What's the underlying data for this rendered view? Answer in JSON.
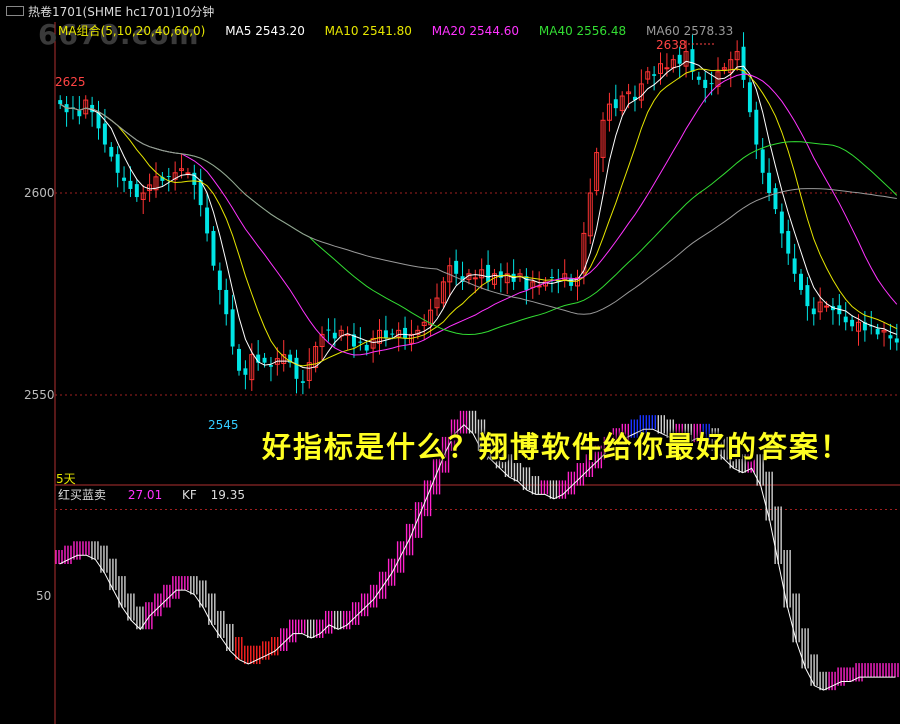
{
  "window": {
    "title": "热卷1701(SHME hc1701)10分钟",
    "watermark": "6670.com"
  },
  "ma_legend": {
    "group_label": "MA组合(5,10,20,40,60,0)",
    "items": [
      {
        "label": "MA5 2543.20",
        "color": "#ffffff"
      },
      {
        "label": "MA10 2541.80",
        "color": "#e6e600"
      },
      {
        "label": "MA20 2544.60",
        "color": "#ff33ff"
      },
      {
        "label": "MA40 2556.48",
        "color": "#33dd33"
      },
      {
        "label": "MA60 2578.33",
        "color": "#999999"
      }
    ]
  },
  "price_axis": {
    "ticks": [
      "2600",
      "2550"
    ]
  },
  "annotations": {
    "high_left": "2625",
    "high_right": "2638",
    "low": "2545",
    "period": "5天"
  },
  "slogan": "好指标是什么？翔博软件给你最好的答案！",
  "indicator": {
    "name": "红买蓝卖",
    "value": "27.01",
    "kf_label": "KF",
    "kf_value": "19.35",
    "axis_tick": "50"
  },
  "chart_data": [
    {
      "type": "candlestick",
      "title": "热卷1701(SHME hc1701)10分钟",
      "ylim": [
        2540,
        2642
      ],
      "series_note": "close values per bar",
      "close": [
        2622,
        2620,
        2621,
        2619,
        2623,
        2620,
        2616,
        2612,
        2609,
        2605,
        2603,
        2601,
        2599,
        2600,
        2602,
        2604,
        2603,
        2604,
        2605,
        2606,
        2605,
        2602,
        2597,
        2590,
        2582,
        2576,
        2570,
        2562,
        2556,
        2555,
        2560,
        2558,
        2558,
        2557,
        2559,
        2560,
        2558,
        2554,
        2553,
        2558,
        2562,
        2565,
        2566,
        2564,
        2566,
        2565,
        2562,
        2563,
        2561,
        2564,
        2566,
        2564,
        2565,
        2566,
        2564,
        2565,
        2566,
        2568,
        2571,
        2574,
        2578,
        2582,
        2580,
        2578,
        2580,
        2579,
        2581,
        2578,
        2580,
        2579,
        2580,
        2578,
        2580,
        2576,
        2578,
        2577,
        2578,
        2579,
        2578,
        2580,
        2577,
        2579,
        2590,
        2600,
        2610,
        2618,
        2622,
        2621,
        2624,
        2625,
        2623,
        2627,
        2630,
        2629,
        2632,
        2631,
        2633,
        2632,
        2635,
        2630,
        2628,
        2626,
        2627,
        2630,
        2631,
        2633,
        2635,
        2628,
        2620,
        2612,
        2605,
        2600,
        2596,
        2590,
        2585,
        2580,
        2576,
        2572,
        2570,
        2573,
        2572,
        2571,
        2570,
        2568,
        2567,
        2568,
        2566,
        2567,
        2565,
        2566,
        2564,
        2563
      ],
      "ma": [
        {
          "name": "MA5",
          "color": "#ffffff"
        },
        {
          "name": "MA10",
          "color": "#e6e600"
        },
        {
          "name": "MA20",
          "color": "#ff33ff"
        },
        {
          "name": "MA40",
          "color": "#33dd33"
        },
        {
          "name": "MA60",
          "color": "#999999"
        }
      ],
      "up_color": "#ff3333",
      "down_color": "#00e5e5",
      "reference_lines": [
        2600,
        2550
      ]
    },
    {
      "type": "bar",
      "title": "红买蓝卖",
      "ylim": [
        0,
        100
      ],
      "reference_lines": [
        50
      ],
      "colors": {
        "buy": "#ff22cc",
        "sell": "#d0d0d0",
        "strong_buy": "#ff2222",
        "strong_sell": "#1a33ff"
      },
      "values": [
        40,
        41,
        42,
        42,
        41,
        38,
        34,
        30,
        27,
        25,
        28,
        30,
        32,
        34,
        34,
        33,
        30,
        26,
        23,
        20,
        18,
        17,
        18,
        19,
        20,
        22,
        24,
        24,
        23,
        24,
        26,
        25,
        26,
        28,
        30,
        32,
        35,
        38,
        42,
        46,
        51,
        56,
        61,
        66,
        70,
        72,
        70,
        66,
        64,
        62,
        60,
        59,
        57,
        56,
        56,
        55,
        56,
        58,
        60,
        62,
        64,
        66,
        68,
        69,
        70,
        71,
        71,
        70,
        69,
        69,
        68,
        69,
        68,
        66,
        64,
        62,
        61,
        62,
        58,
        50,
        40,
        30,
        22,
        16,
        12,
        11,
        12,
        13,
        13,
        14,
        14,
        14,
        14,
        14
      ]
    }
  ]
}
